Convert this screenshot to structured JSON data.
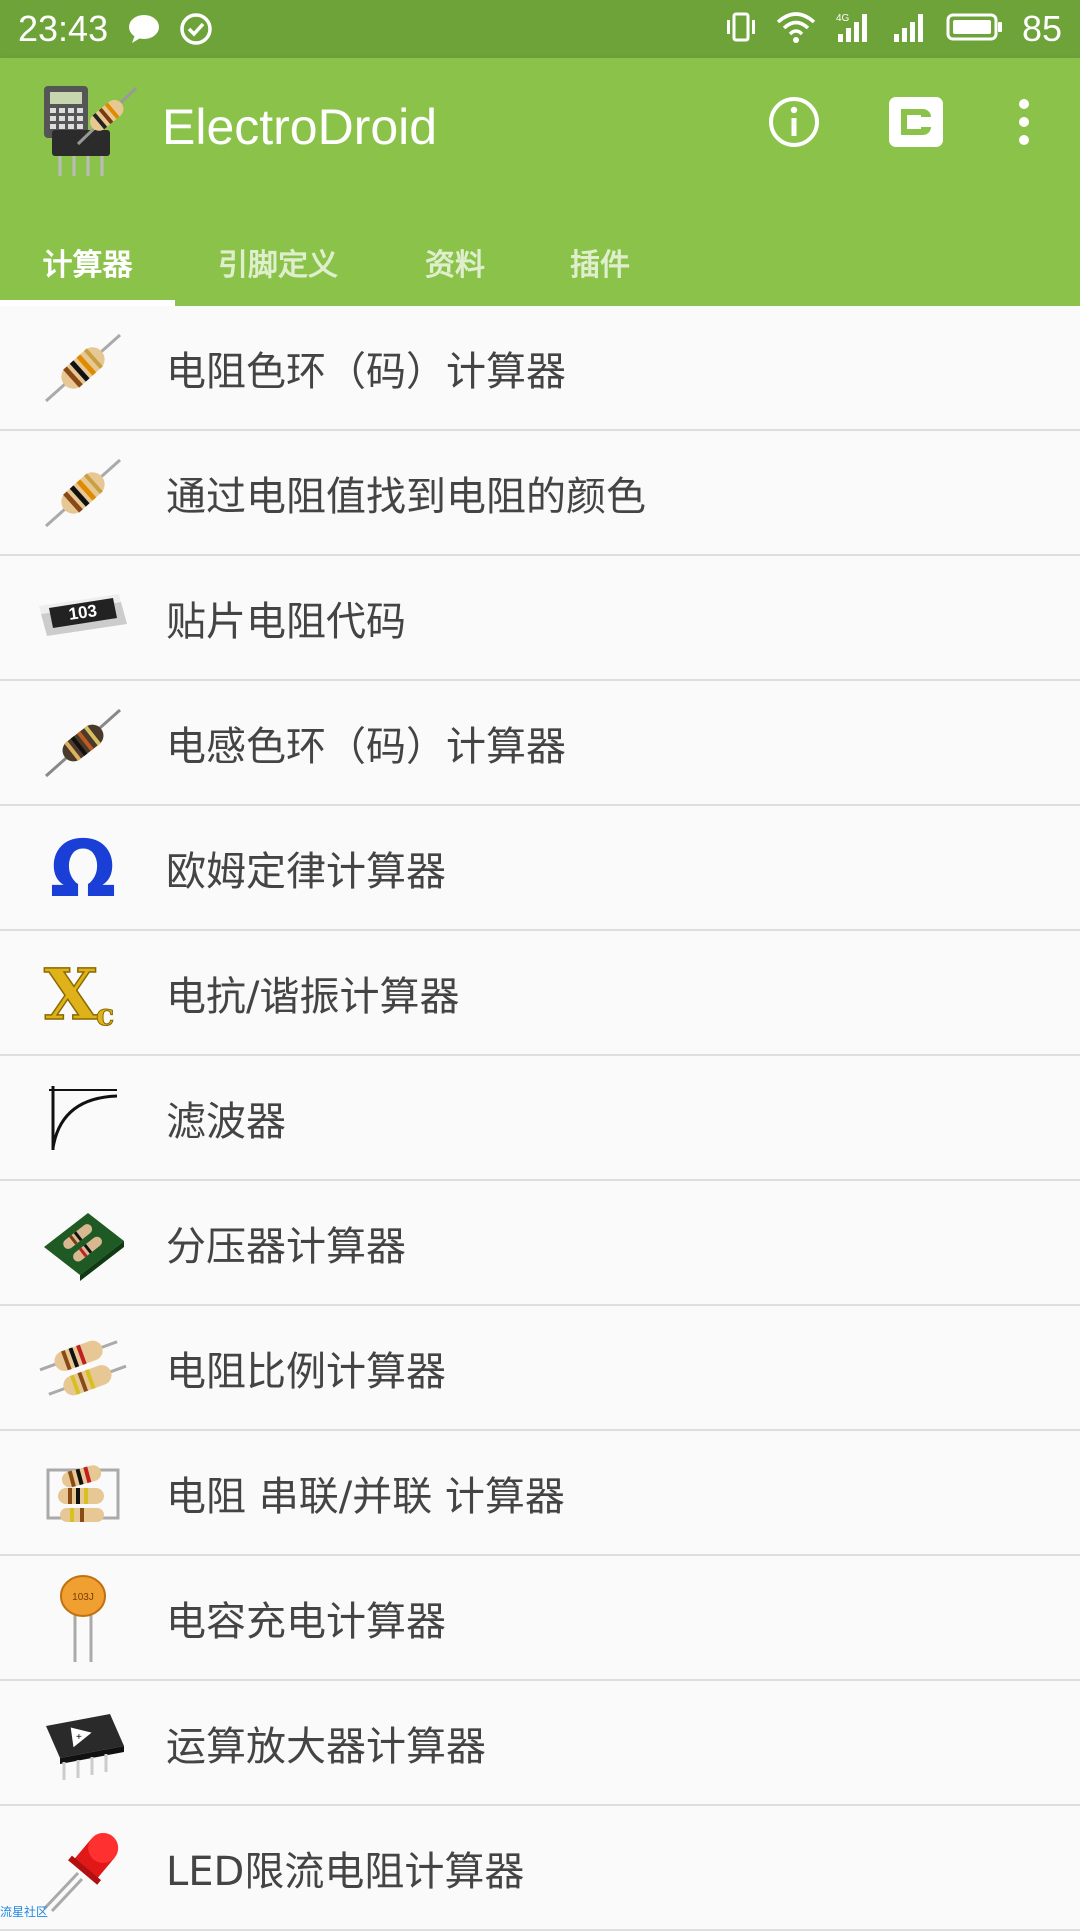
{
  "status": {
    "time": "23:43",
    "battery": "85"
  },
  "app": {
    "title": "ElectroDroid"
  },
  "actions": {
    "info_icon": "info-icon",
    "plugin_icon": "plugin-icon",
    "more_icon": "more-vertical-icon"
  },
  "tabs": [
    {
      "label": "计算器",
      "active": true
    },
    {
      "label": "引脚定义",
      "active": false
    },
    {
      "label": "资料",
      "active": false
    },
    {
      "label": "插件",
      "active": false
    }
  ],
  "items": [
    {
      "label": "电阻色环（码）计算器",
      "icon": "resistor-icon"
    },
    {
      "label": "通过电阻值找到电阻的颜色",
      "icon": "resistor-icon"
    },
    {
      "label": "贴片电阻代码",
      "icon": "smd-resistor-icon"
    },
    {
      "label": "电感色环（码）计算器",
      "icon": "inductor-icon"
    },
    {
      "label": "欧姆定律计算器",
      "icon": "omega-icon"
    },
    {
      "label": "电抗/谐振计算器",
      "icon": "xc-icon"
    },
    {
      "label": "滤波器",
      "icon": "filter-curve-icon"
    },
    {
      "label": "分压器计算器",
      "icon": "pcb-divider-icon"
    },
    {
      "label": "电阻比例计算器",
      "icon": "resistor-pair-icon"
    },
    {
      "label": "电阻 串联/并联 计算器",
      "icon": "resistor-network-icon"
    },
    {
      "label": "电容充电计算器",
      "icon": "capacitor-icon"
    },
    {
      "label": "运算放大器计算器",
      "icon": "opamp-icon"
    },
    {
      "label": "LED限流电阻计算器",
      "icon": "led-icon"
    }
  ],
  "smd_code": "103",
  "capacitor_code": "103J",
  "watermark": "流星社区",
  "colors": {
    "status_bar": "#6ea33a",
    "app_bar": "#8bc34a",
    "omega_blue": "#1a3fd6",
    "xc_gold": "#e0b21a"
  }
}
